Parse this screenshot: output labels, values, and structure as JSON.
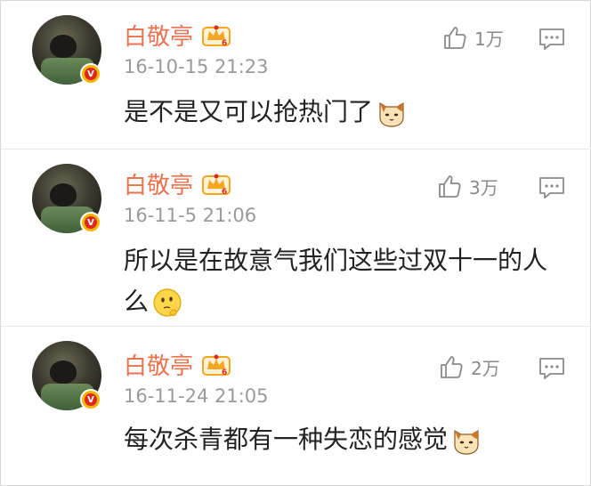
{
  "comments": [
    {
      "user": "白敬亭",
      "time": "16-10-15 21:23",
      "likes": "1万",
      "text": "是不是又可以抢热门了",
      "emoji": "cat-face-icon"
    },
    {
      "user": "白敬亭",
      "time": "16-11-5 21:06",
      "likes": "3万",
      "text": "所以是在故意气我们这些过双十一的人么",
      "emoji": "thinking-face-icon"
    },
    {
      "user": "白敬亭",
      "time": "16-11-24 21:05",
      "likes": "2万",
      "text": "每次杀青都有一种失恋的感觉",
      "emoji": "cat-face-icon"
    }
  ],
  "colors": {
    "username": "#eb7350",
    "timestamp": "#9a9a9a",
    "text": "#222222",
    "verified_badge": "#f4b400",
    "vip_crown": "#f5a623"
  }
}
